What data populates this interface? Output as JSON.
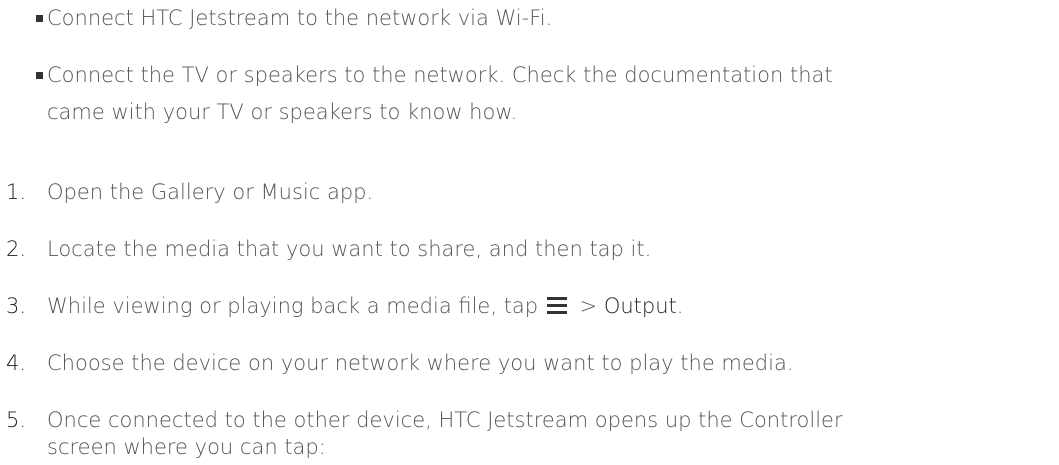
{
  "bullets": [
    {
      "text": "Connect HTC Jetstream to the network via Wi-Fi."
    },
    {
      "line1": "Connect the TV or speakers to the network. Check the documentation that",
      "line2": "came with your TV or speakers to know how."
    }
  ],
  "steps": [
    {
      "number": "1.",
      "text": "Open the Gallery or Music app."
    },
    {
      "number": "2.",
      "text": "Locate the media that you want to share, and then tap it."
    },
    {
      "number": "3.",
      "text_before": "While viewing or playing back a media file, tap",
      "separator": ">",
      "ui_term": "Output",
      "text_after": ".",
      "icon": "menu-icon"
    },
    {
      "number": "4.",
      "text": "Choose the device on your network where you want to play the media."
    },
    {
      "number": "5.",
      "line1": "Once connected to the other device, HTC Jetstream opens up the Controller",
      "line2": "screen where you can tap:"
    }
  ]
}
